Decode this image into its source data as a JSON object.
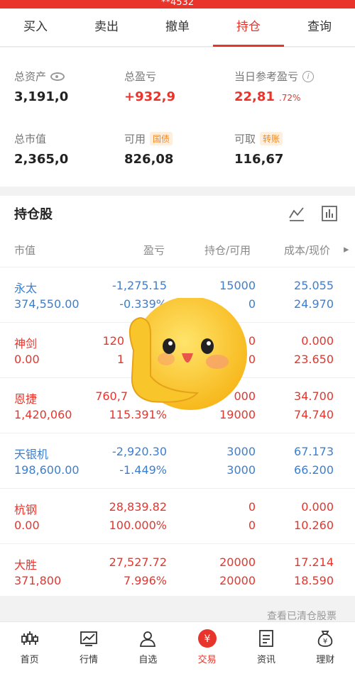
{
  "status_bar": {
    "text": "**4532"
  },
  "tabs": [
    {
      "label": "买入"
    },
    {
      "label": "卖出"
    },
    {
      "label": "撤单"
    },
    {
      "label": "持仓"
    },
    {
      "label": "查询"
    }
  ],
  "summary": {
    "total_assets": {
      "label": "总资产",
      "value": "3,191,0"
    },
    "total_pl": {
      "label": "总盈亏",
      "value": "+932,9"
    },
    "today_pl": {
      "label": "当日参考盈亏",
      "value": "22,81",
      "pct": ".72%"
    },
    "market_value": {
      "label": "总市值",
      "value": "2,365,0"
    },
    "available": {
      "label": "可用",
      "tag": "国债",
      "value": "826,08"
    },
    "withdrawable": {
      "label": "可取",
      "tag": "转账",
      "value": "116,67"
    }
  },
  "holdings": {
    "title": "持仓股",
    "columns": [
      "市值",
      "盈亏",
      "持仓/可用",
      "成本/现价"
    ],
    "rows": [
      {
        "name": "永太",
        "mv": "374,550.00",
        "pl": "-1,275.15",
        "pl_pct": "-0.339%",
        "hold": "15000",
        "avail": "0",
        "cost": "25.055",
        "price": "24.970",
        "color": "blue"
      },
      {
        "name": "神剑",
        "mv": "0.00",
        "pl": "120",
        "pl_pct": "1",
        "hold": "0",
        "avail": "0",
        "cost": "0.000",
        "price": "23.650",
        "color": "red"
      },
      {
        "name": "恩捷",
        "mv": "1,420,060",
        "pl": "760,7",
        "pl_pct": "115.391%",
        "hold": "000",
        "avail": "19000",
        "cost": "34.700",
        "price": "74.740",
        "color": "red"
      },
      {
        "name": "天银机",
        "mv": "198,600.00",
        "pl": "-2,920.30",
        "pl_pct": "-1.449%",
        "hold": "3000",
        "avail": "3000",
        "cost": "67.173",
        "price": "66.200",
        "color": "blue"
      },
      {
        "name": "杭钢",
        "mv": "0.00",
        "pl": "28,839.82",
        "pl_pct": "100.000%",
        "hold": "0",
        "avail": "0",
        "cost": "0.000",
        "price": "10.260",
        "color": "red"
      },
      {
        "name": "大胜",
        "mv": "371,800",
        "pl": "27,527.72",
        "pl_pct": "7.996%",
        "hold": "20000",
        "avail": "20000",
        "cost": "17.214",
        "price": "18.590",
        "color": "red"
      }
    ],
    "view_cleared": "查看已清仓股票"
  },
  "nav": [
    {
      "label": "首页",
      "icon": "candlestick-icon"
    },
    {
      "label": "行情",
      "icon": "chart-icon"
    },
    {
      "label": "自选",
      "icon": "person-icon"
    },
    {
      "label": "交易",
      "icon": "yen-icon"
    },
    {
      "label": "资讯",
      "icon": "document-icon"
    },
    {
      "label": "理财",
      "icon": "money-bag-icon"
    }
  ],
  "colors": {
    "accent": "#e8342b",
    "blue": "#3b7fd1"
  }
}
